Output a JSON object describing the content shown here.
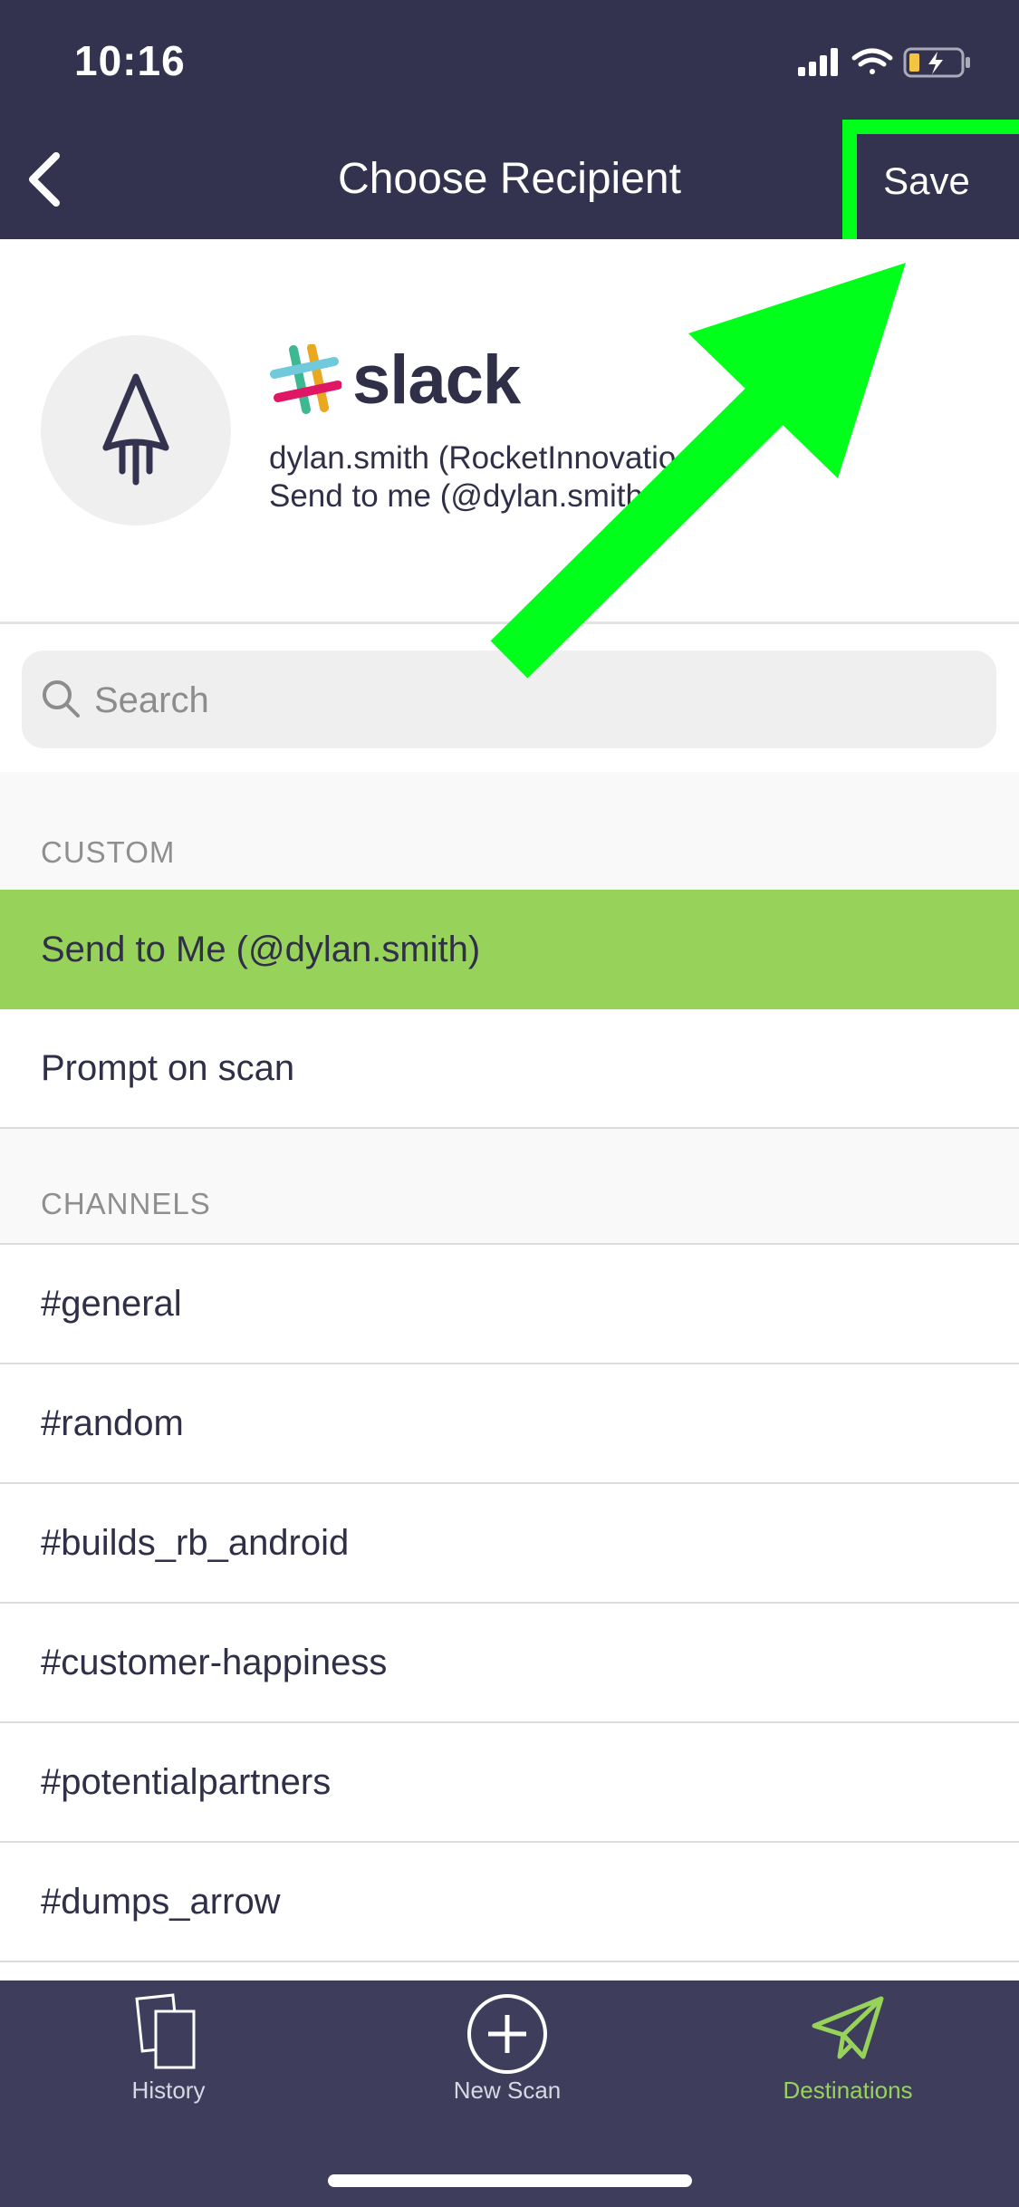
{
  "status_bar": {
    "time": "10:16"
  },
  "nav": {
    "title": "Choose Recipient",
    "save_label": "Save",
    "accent": "#00ff1a"
  },
  "account": {
    "service_name": "slack",
    "line1": "dylan.smith (RocketInnovatio",
    "line2": "Send to me (@dylan.smith"
  },
  "search": {
    "placeholder": "Search",
    "value": ""
  },
  "sections": {
    "custom_header": "CUSTOM",
    "channels_header": "CHANNELS"
  },
  "custom_items": [
    {
      "label": "Send to Me (@dylan.smith)",
      "selected": true
    },
    {
      "label": "Prompt on scan",
      "selected": false
    }
  ],
  "channels": [
    "#general",
    "#random",
    "#builds_rb_android",
    "#customer-happiness",
    "#potentialpartners",
    "#dumps_arrow"
  ],
  "tabs": [
    {
      "label": "History",
      "icon": "history-icon"
    },
    {
      "label": "New Scan",
      "icon": "new-scan-icon"
    },
    {
      "label": "Destinations",
      "icon": "paper-plane-icon",
      "active": true
    }
  ],
  "colors": {
    "header_bg": "#33334f",
    "selected_row": "#97d35a",
    "tab_bar_bg": "#3e3e5c"
  }
}
